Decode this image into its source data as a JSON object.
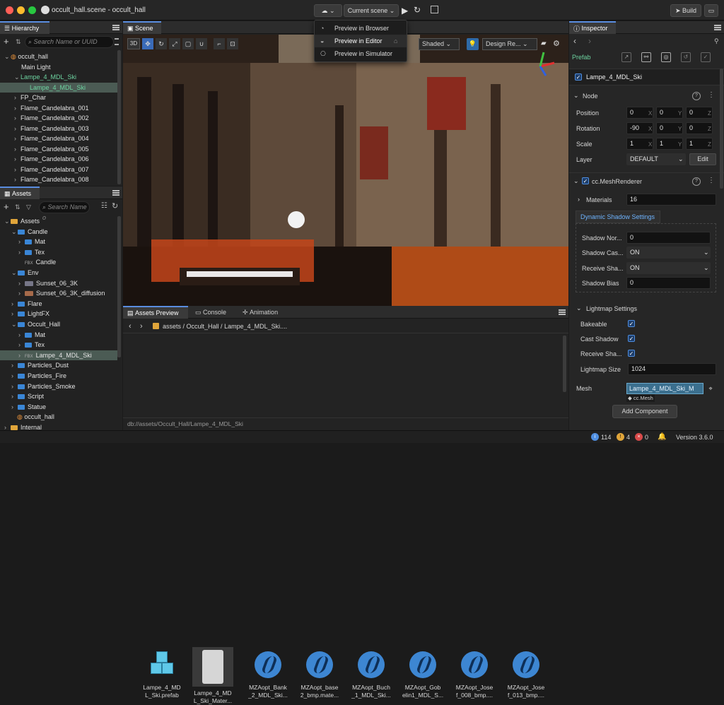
{
  "window": {
    "title": "occult_hall.scene - occult_hall"
  },
  "toolbar": {
    "scene_select": "Current scene",
    "build": "Build"
  },
  "preview_menu": {
    "items": [
      "Preview in Browser",
      "Preview in Editor",
      "Preview in Simulator"
    ],
    "selected": "Preview in Editor"
  },
  "hierarchy": {
    "title": "Hierarchy",
    "search_placeholder": "Search Name or UUID",
    "rows": [
      "occult_hall",
      "Main Light",
      "Lampe_4_MDL_Ski",
      "Lampe_4_MDL_Ski",
      "FP_Char",
      "Flame_Candelabra_001",
      "Flame_Candelabra_002",
      "Flame_Candelabra_003",
      "Flame_Candelabra_004",
      "Flame_Candelabra_005",
      "Flame_Candelabra_006",
      "Flame_Candelabra_007",
      "Flame_Candelabra_008"
    ]
  },
  "assets": {
    "title": "Assets",
    "search_placeholder": "Search Name o",
    "rows": [
      "Assets",
      "Candle",
      "Mat",
      "Tex",
      "Candle",
      "Env",
      "Sunset_06_3K",
      "Sunset_06_3K_diffusion",
      "Flare",
      "LightFX",
      "Occult_Hall",
      "Mat",
      "Tex",
      "Lampe_4_MDL_Ski",
      "Particles_Dust",
      "Particles_Fire",
      "Particles_Smoke",
      "Script",
      "Statue",
      "occult_hall",
      "Internal"
    ],
    "fbx_badge": "FBX"
  },
  "scene": {
    "title": "Scene",
    "mode_3d": "3D",
    "shading": "Shaded",
    "layout": "Design Re..."
  },
  "bottom": {
    "tabs": [
      "Assets Preview",
      "Console",
      "Animation"
    ],
    "breadcrumb": [
      "assets",
      "Occult_Hall",
      "Lampe_4_MDL_Ski...."
    ],
    "items": [
      {
        "line1": "Lampe_4_MD",
        "line2": "L_Ski.prefab"
      },
      {
        "line1": "Lampe_4_MD",
        "line2": "L_Ski_Mater..."
      },
      {
        "line1": "MZAopt_Bank",
        "line2": "_2_MDL_Ski..."
      },
      {
        "line1": "MZAopt_base",
        "line2": "2_bmp.mate..."
      },
      {
        "line1": "MZAopt_Buch",
        "line2": "_1_MDL_Ski..."
      },
      {
        "line1": "MZAopt_Gob",
        "line2": "elin1_MDL_S..."
      },
      {
        "line1": "MZAopt_Jose",
        "line2": "f_008_bmp...."
      },
      {
        "line1": "MZAopt_Jose",
        "line2": "f_013_bmp...."
      }
    ],
    "path": "db://assets/Occult_Hall/Lampe_4_MDL_Ski"
  },
  "inspector": {
    "title": "Inspector",
    "prefab_label": "Prefab",
    "node_name": "Lampe_4_MDL_Ski",
    "node_section": "Node",
    "position": {
      "label": "Position",
      "x": "0",
      "y": "0",
      "z": "0"
    },
    "rotation": {
      "label": "Rotation",
      "x": "-90",
      "y": "0",
      "z": "0"
    },
    "scale": {
      "label": "Scale",
      "x": "1",
      "y": "1",
      "z": "1"
    },
    "axes": {
      "x": "X",
      "y": "Y",
      "z": "Z"
    },
    "layer": {
      "label": "Layer",
      "value": "DEFAULT",
      "edit": "Edit"
    },
    "mesh_renderer": "cc.MeshRenderer",
    "materials": {
      "label": "Materials",
      "value": "16"
    },
    "dynamic_shadow": "Dynamic Shadow Settings",
    "shadow_normal": {
      "label": "Shadow Nor...",
      "value": "0"
    },
    "shadow_cast": {
      "label": "Shadow Cas...",
      "value": "ON"
    },
    "shadow_receive": {
      "label": "Receive Sha...",
      "value": "ON"
    },
    "shadow_bias": {
      "label": "Shadow Bias",
      "value": "0"
    },
    "lightmap": "Lightmap Settings",
    "bakeable": "Bakeable",
    "cast_shadow": "Cast Shadow",
    "receive_shadow": "Receive Sha...",
    "lightmap_size": {
      "label": "Lightmap Size",
      "value": "1024"
    },
    "mesh": {
      "label": "Mesh",
      "value": "Lampe_4_MDL_Ski_M",
      "tag": "cc.Mesh"
    },
    "add_component": "Add Component"
  },
  "status": {
    "info": "114",
    "warn": "4",
    "error": "0",
    "version": "Version 3.6.0"
  },
  "colors": {
    "accent": "#4f8ee0",
    "selected_row": "#4b5b54",
    "folder": "#3a86d6"
  }
}
